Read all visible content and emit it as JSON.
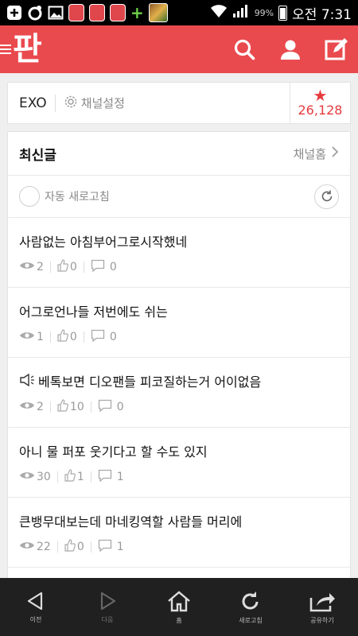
{
  "status_bar": {
    "battery_percent": "99%",
    "time": "오전 7:31"
  },
  "app": {
    "logo": "판"
  },
  "channel": {
    "name": "EXO",
    "settings_label": "채널설정",
    "star_count": "26,128"
  },
  "feed": {
    "title": "최신글",
    "channel_home_label": "채널홈",
    "auto_refresh_label": "자동 새로고침",
    "posts": [
      {
        "title": "사람없는 아침부어그로시작했네",
        "views": "2",
        "likes": "0",
        "comments": "0",
        "has_speaker": false
      },
      {
        "title": "어그로언나들 저번에도 쉬는",
        "views": "1",
        "likes": "0",
        "comments": "0",
        "has_speaker": false
      },
      {
        "title": "베톡보면 디오팬들 피코질하는거 어이없음",
        "views": "2",
        "likes": "10",
        "comments": "0",
        "has_speaker": true
      },
      {
        "title": "아니 물 퍼포 웃기다고 할 수도 있지",
        "views": "30",
        "likes": "1",
        "comments": "1",
        "has_speaker": false
      },
      {
        "title": "큰뱅무대보는데 마네킹역할 사람들 머리에",
        "views": "22",
        "likes": "0",
        "comments": "1",
        "has_speaker": false
      }
    ]
  },
  "bottom_nav": {
    "prev": "이전",
    "next": "다음",
    "home": "홈",
    "refresh": "새로고침",
    "share": "공유하기"
  },
  "colors": {
    "brand": "#e94a4e",
    "star": "#e63b3e"
  }
}
